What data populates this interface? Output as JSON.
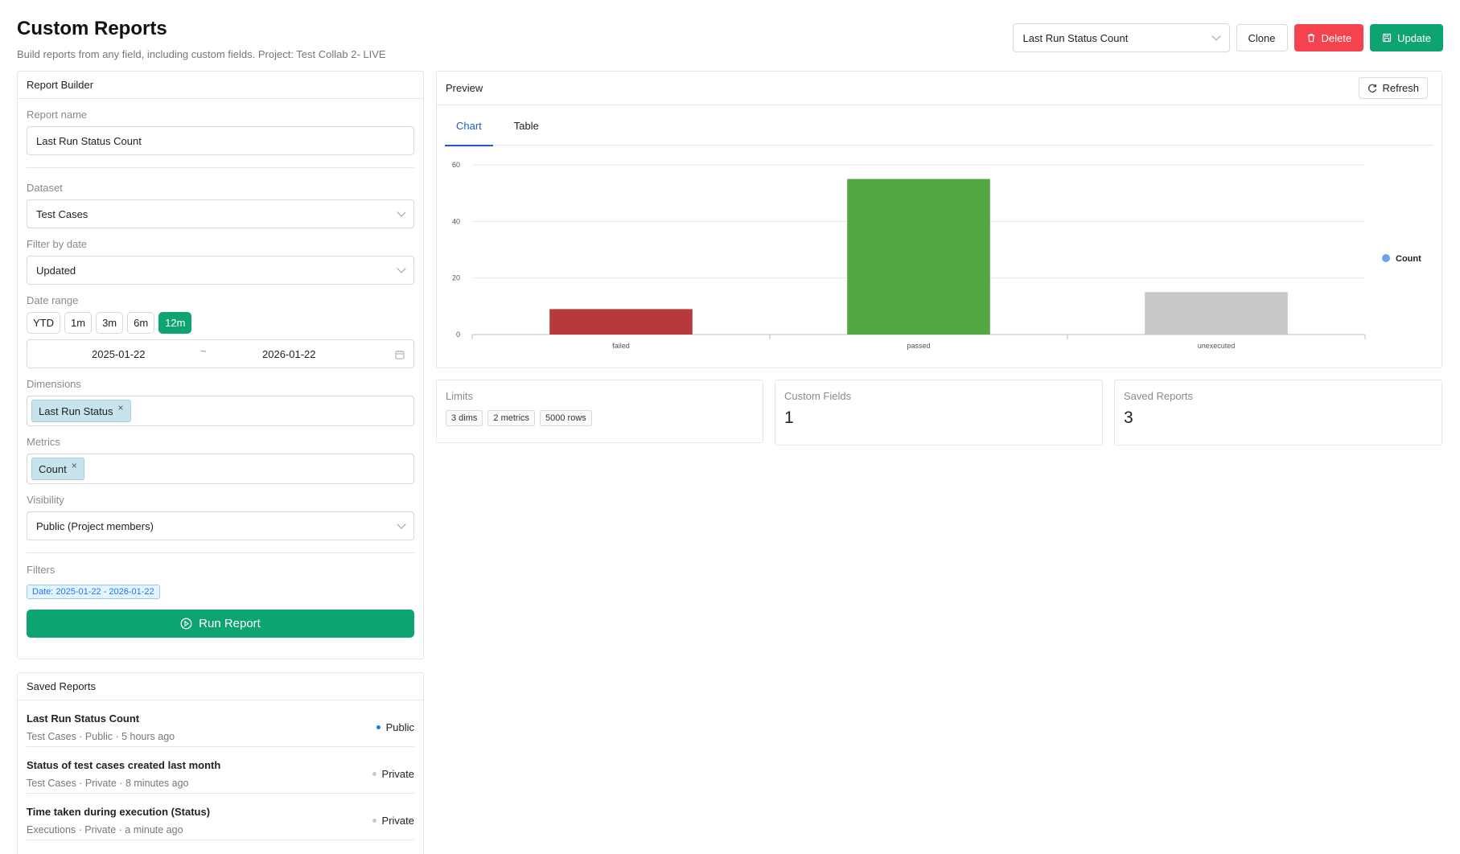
{
  "header": {
    "title": "Custom Reports",
    "subtitle": "Build reports from any field, including custom fields. Project: Test Collab 2- LIVE",
    "selected_report": "Last Run Status Count",
    "clone_label": "Clone",
    "delete_label": "Delete",
    "update_label": "Update"
  },
  "builder": {
    "title": "Report Builder",
    "report_name_label": "Report name",
    "report_name_value": "Last Run Status Count",
    "dataset_label": "Dataset",
    "dataset_value": "Test Cases",
    "filter_date_label": "Filter by date",
    "filter_date_value": "Updated",
    "date_range_label": "Date range",
    "presets": [
      "YTD",
      "1m",
      "3m",
      "6m",
      "12m"
    ],
    "active_preset": "12m",
    "date_start": "2025-01-22",
    "date_sep": "~",
    "date_end": "2026-01-22",
    "dimensions_label": "Dimensions",
    "dimension_tag": "Last Run Status",
    "metrics_label": "Metrics",
    "metric_tag": "Count",
    "visibility_label": "Visibility",
    "visibility_value": "Public (Project members)",
    "filters_label": "Filters",
    "filter_chip": "Date: 2025-01-22 - 2026-01-22",
    "run_label": "Run Report"
  },
  "saved": {
    "title": "Saved Reports",
    "items": [
      {
        "name": "Last Run Status Count",
        "meta": "Test Cases · Public · 5 hours ago",
        "visibility": "Public"
      },
      {
        "name": "Status of test cases created last month",
        "meta": "Test Cases · Private · 8 minutes ago",
        "visibility": "Private"
      },
      {
        "name": "Time taken during execution (Status)",
        "meta": "Executions · Private · a minute ago",
        "visibility": "Private"
      }
    ]
  },
  "preview": {
    "title": "Preview",
    "refresh_label": "Refresh",
    "tabs": [
      "Chart",
      "Table"
    ]
  },
  "chart_data": {
    "type": "bar",
    "categories": [
      "failed",
      "passed",
      "unexecuted"
    ],
    "series": [
      {
        "name": "Count",
        "values": [
          9,
          55,
          15
        ]
      }
    ],
    "bar_colors": [
      "#b8393c",
      "#54a842",
      "#c8c8c8"
    ],
    "legend_color": "#6ba3e8",
    "yticks": [
      0,
      20,
      40,
      60
    ],
    "ylim": [
      0,
      60
    ],
    "legend": "right",
    "grid": true
  },
  "cards": {
    "limits_label": "Limits",
    "limit_tags": [
      "3 dims",
      "2 metrics",
      "5000 rows"
    ],
    "custom_fields_label": "Custom Fields",
    "custom_fields_value": "1",
    "saved_reports_label": "Saved Reports",
    "saved_reports_value": "3"
  }
}
